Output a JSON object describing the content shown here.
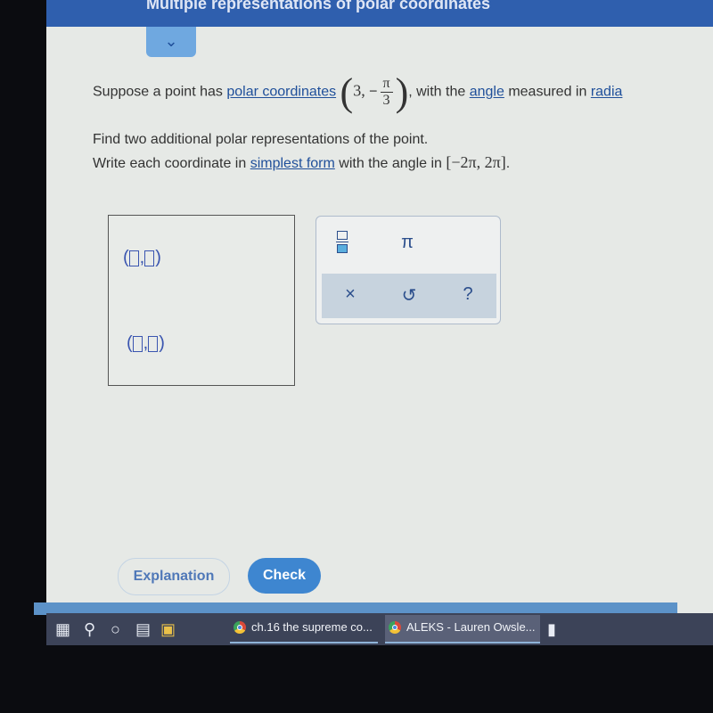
{
  "header": {
    "title": "Multiple representations of polar coordinates",
    "collapse_icon": "chevron-down-icon"
  },
  "question": {
    "line1_prefix": "Suppose a point has",
    "link_polar": "polar coordinates",
    "coord_r": "3,",
    "coord_sign": "−",
    "coord_num": "π",
    "coord_den": "3",
    "line1_mid": ", with the",
    "link_angle": "angle",
    "line1_suffix": "measured in",
    "link_radians": "radia",
    "line2": "Find two additional polar representations of the point.",
    "line3_prefix": "Write each coordinate in",
    "link_simplest": "simplest form",
    "line3_mid": "with the angle in",
    "interval": "[−2π,  2π]",
    "period": "."
  },
  "keypad": {
    "fraction_icon": "fraction-icon",
    "pi": "π",
    "clear": "×",
    "undo": "↺",
    "help": "?"
  },
  "buttons": {
    "explanation": "Explanation",
    "check": "Check"
  },
  "taskbar": {
    "items": [
      {
        "label": "ch.16 the supreme co..."
      },
      {
        "label": "ALEKS - Lauren Owsle..."
      }
    ]
  }
}
